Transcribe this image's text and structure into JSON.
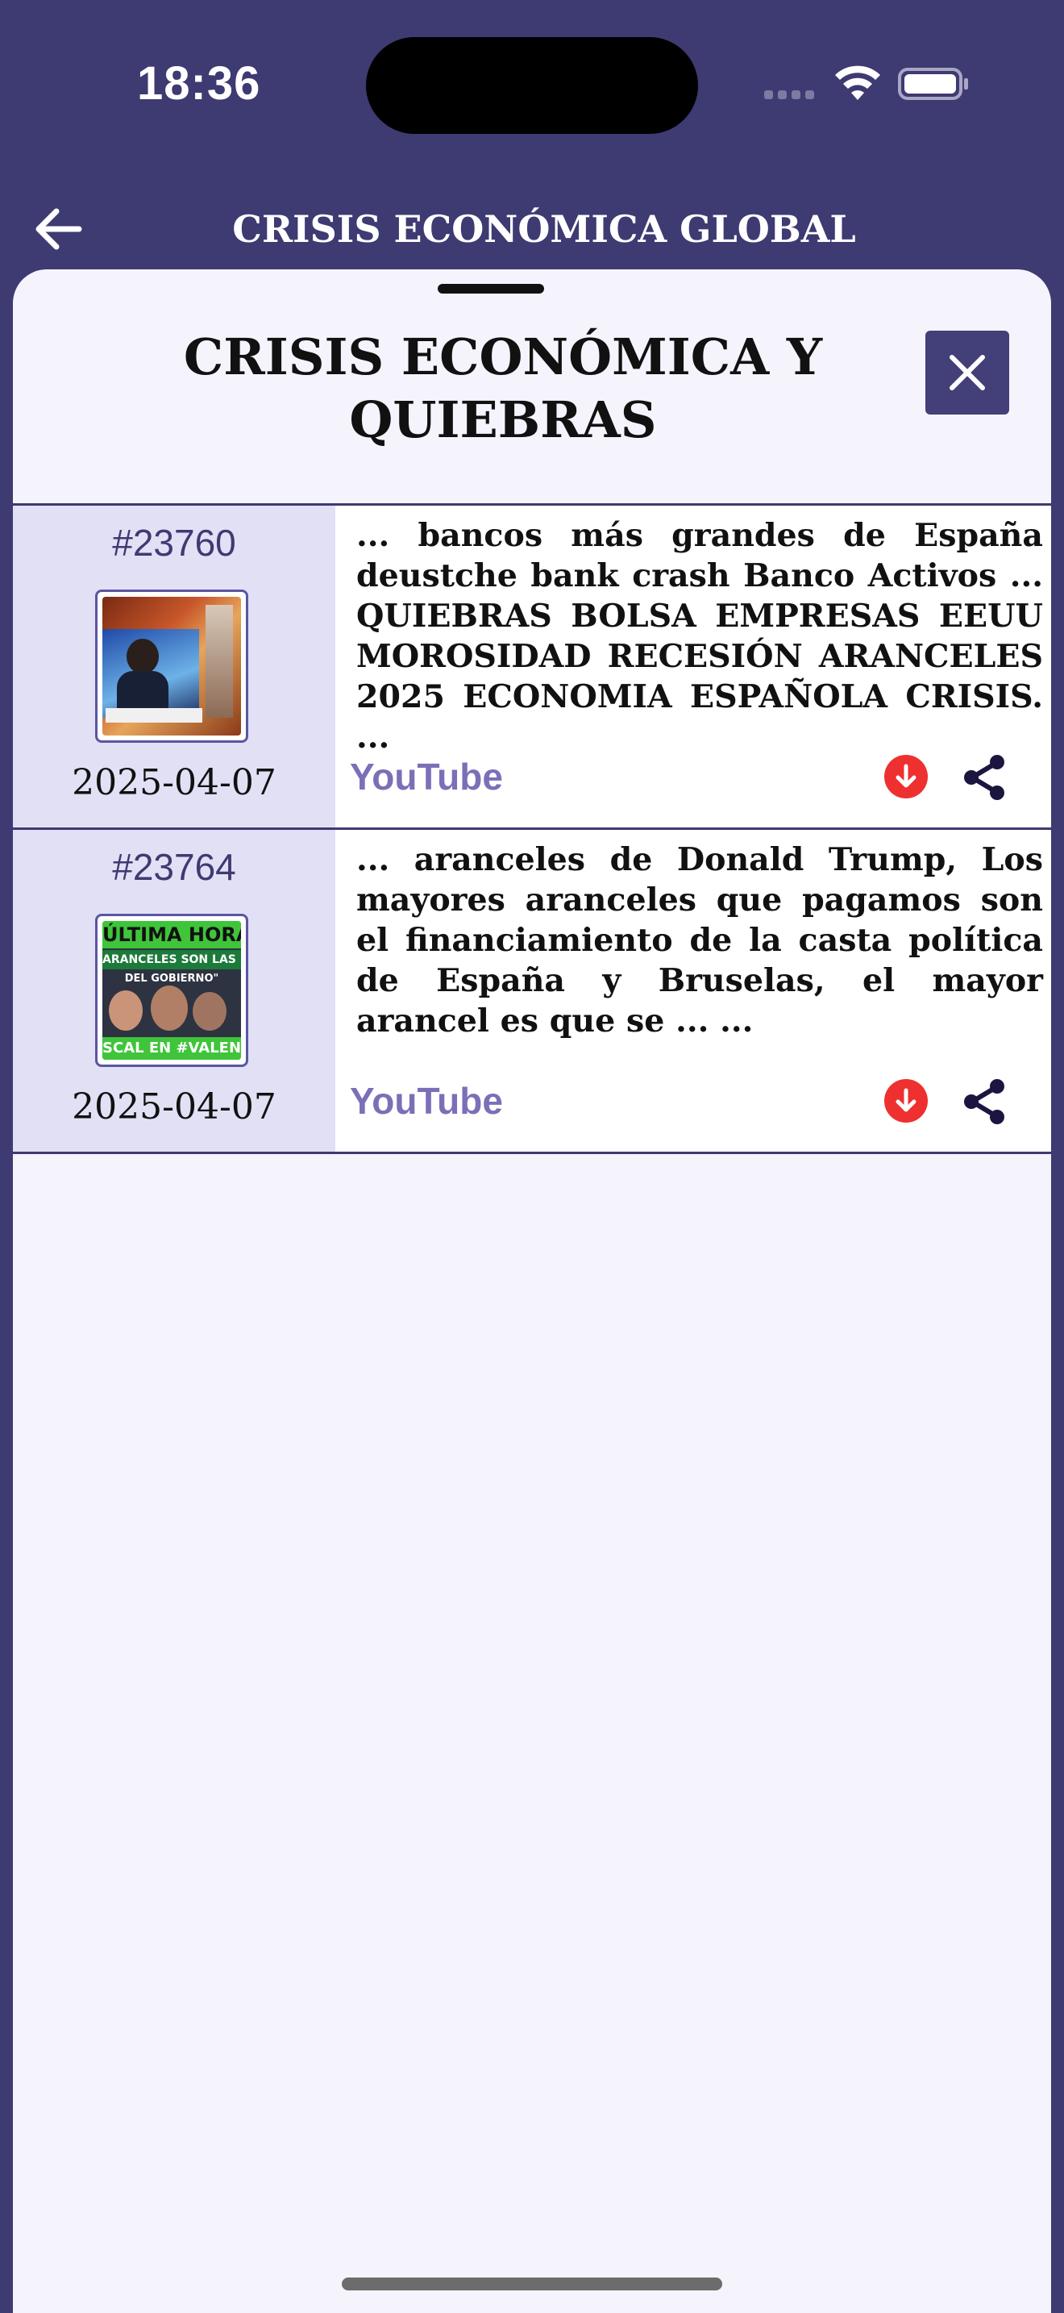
{
  "status_bar": {
    "time": "18:36"
  },
  "nav": {
    "back_icon": "arrow-left-icon",
    "title": "CRISIS ECONÓMICA GLOBAL"
  },
  "sheet": {
    "title_line1": "CRISIS ECONÓMICA Y",
    "title_line2": "QUIEBRAS",
    "close_icon": "close-icon",
    "accent_color": "#3e3a72"
  },
  "items": [
    {
      "id": "#23760",
      "date": "2025-04-07",
      "text": "... bancos más grandes de España deustche bank crash Banco Activos ... QUIEBRAS BOLSA EMPRESAS EEUU MOROSIDAD RECESIÓN ARANCELES 2025 ECONOMIA ESPAÑOLA CRISIS. ...",
      "source": "YouTube",
      "download_icon": "download-icon",
      "share_icon": "share-icon"
    },
    {
      "id": "#23764",
      "date": "2025-04-07",
      "text": "... aranceles de Donald Trump, Los mayores aranceles que pagamos son el financiamiento de la casta política de España y Bruselas, el mayor arancel es que se ... ...",
      "source": "YouTube",
      "thumb_caption_top": "ÚLTIMA HORA",
      "thumb_caption_mid": "ARANCELES SON LAS P",
      "thumb_caption_sub": "DEL GOBIERNO\"",
      "thumb_caption_bottom": "SCAL EN #VALEN",
      "download_icon": "download-icon",
      "share_icon": "share-icon"
    }
  ]
}
